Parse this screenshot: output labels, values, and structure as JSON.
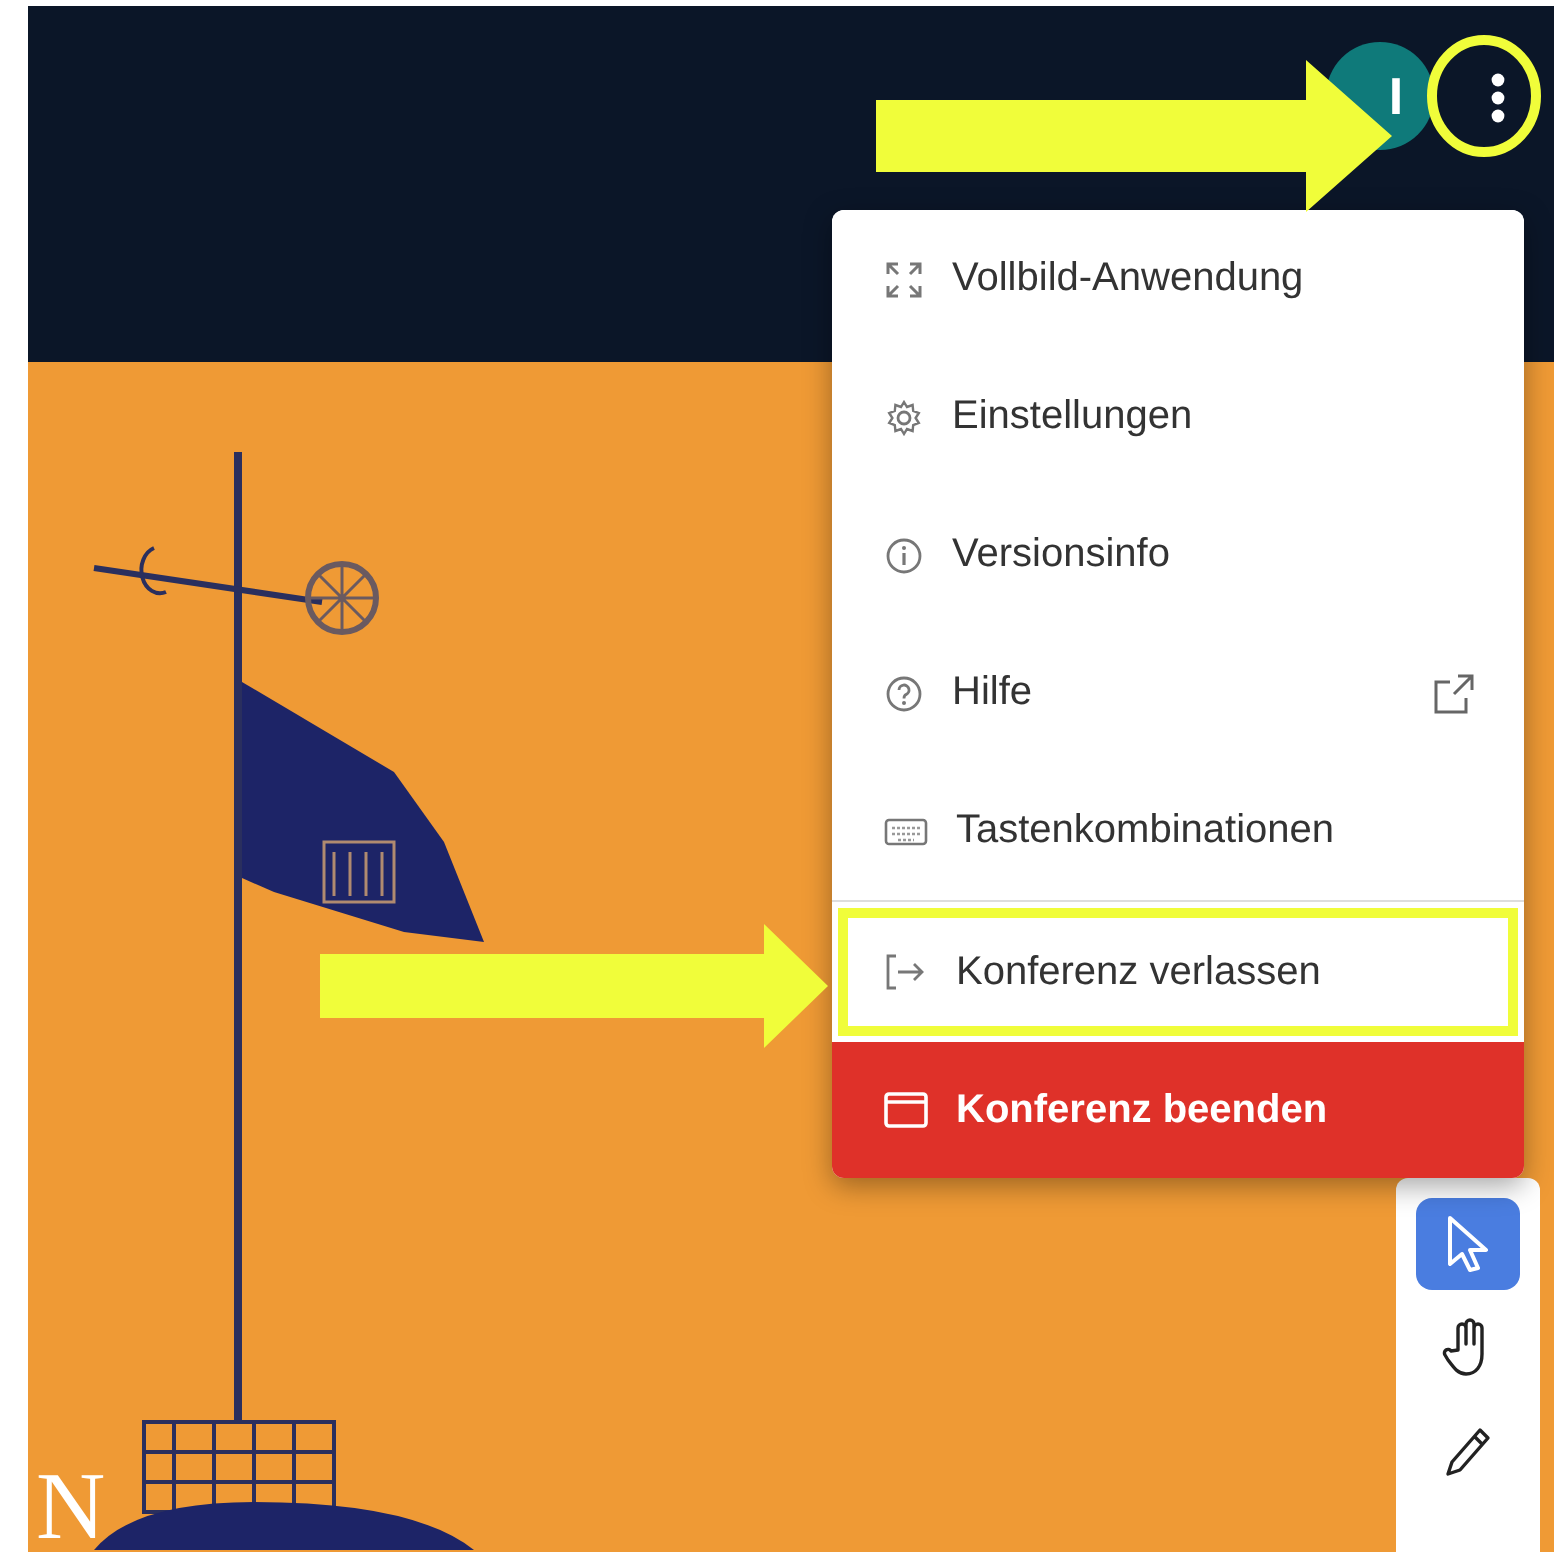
{
  "header": {
    "avatar_initial": "I"
  },
  "menu": {
    "items": [
      {
        "kind": "item",
        "label": "Vollbild-Anwendung",
        "external": false,
        "annotated": false
      },
      {
        "kind": "item",
        "label": "Einstellungen",
        "external": false,
        "annotated": false
      },
      {
        "kind": "item",
        "label": "Versionsinfo",
        "external": false,
        "annotated": false
      },
      {
        "kind": "item",
        "label": "Hilfe",
        "external": true,
        "annotated": false
      },
      {
        "kind": "item",
        "label": "Tastenkombinationen",
        "external": false,
        "annotated": false
      },
      {
        "kind": "item",
        "label": "Konferenz verlassen",
        "external": false,
        "annotated": true
      },
      {
        "kind": "danger",
        "label": "Konferenz beenden",
        "external": false,
        "annotated": false
      }
    ]
  },
  "toolbar": {
    "tools": [
      {
        "selected": true
      },
      {
        "selected": false
      },
      {
        "selected": false
      }
    ]
  },
  "slide": {
    "text": "N"
  }
}
